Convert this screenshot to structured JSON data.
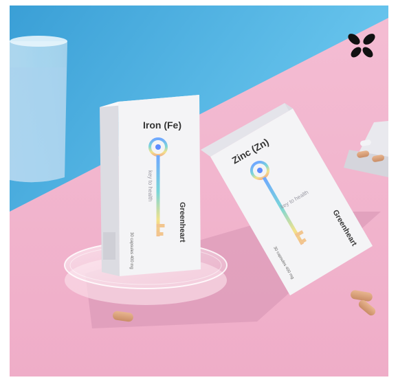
{
  "photo": {
    "brand_mark_icon": "pinwheel-logo-icon",
    "products": [
      {
        "name": "Iron (Fe)",
        "brand": "Greenheart",
        "tagline": "key to health",
        "count_text": "30 capsules 400 mg"
      },
      {
        "name": "Zinc (Zn)",
        "brand": "Greenheart",
        "tagline": "key to health",
        "count_text": "30 capsules 400 mg"
      }
    ],
    "colors": {
      "sky_blue": "#4fb6e6",
      "pink_surface": "#f2b6cf",
      "box_white": "#f4f4f6",
      "capsule": "#d8a07a"
    }
  }
}
